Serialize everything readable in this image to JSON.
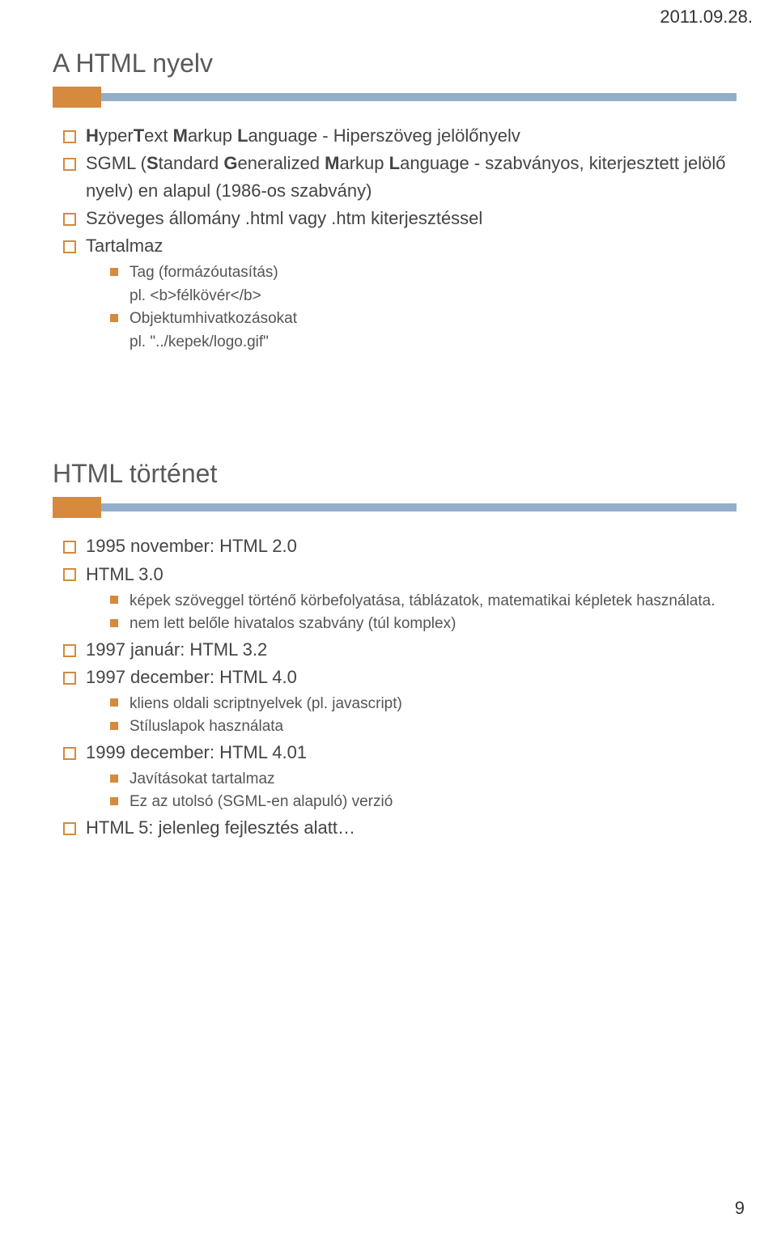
{
  "header": {
    "date": "2011.09.28."
  },
  "footer": {
    "page_number": "9"
  },
  "slide1": {
    "title": "A HTML nyelv",
    "items": [
      {
        "pre": "",
        "b1": "H",
        "mid1": "yper",
        "b2": "T",
        "mid2": "ext ",
        "b3": "M",
        "mid3": "arkup ",
        "b4": "L",
        "post": "anguage - Hiperszöveg jelölőnyelv"
      },
      {
        "pre": "SGML (",
        "b1": "S",
        "mid1": "tandard ",
        "b2": "G",
        "mid2": "eneralized ",
        "b3": "M",
        "mid3": "arkup ",
        "b4": "L",
        "post": "anguage - szabványos, kiterjesztett jelölő nyelv) en alapul (1986-os szabvány)"
      },
      {
        "text": "Szöveges állomány .html vagy .htm kiterjesztéssel"
      },
      {
        "text": "Tartalmaz"
      }
    ],
    "sub_tag": {
      "line1": "Tag (formázóutasítás)",
      "line2": "pl. <b>félkövér</b>"
    },
    "sub_obj": {
      "line1": "Objektumhivatkozásokat",
      "line2": "pl. \"../kepek/logo.gif\""
    }
  },
  "slide2": {
    "title": "HTML történet",
    "items": {
      "i1": "1995 november: HTML 2.0",
      "i2": "HTML 3.0",
      "i2a": "képek szöveggel történő körbefolyatása, táblázatok, matematikai képletek használata.",
      "i2b": "nem lett belőle hivatalos szabvány (túl komplex)",
      "i3": "1997 január: HTML 3.2",
      "i4": "1997 december: HTML 4.0",
      "i4a": "kliens oldali scriptnyelvek (pl. javascript)",
      "i4b": "Stíluslapok használata",
      "i5": "1999 december: HTML 4.01",
      "i5a": "Javításokat tartalmaz",
      "i5b": "Ez az utolsó (SGML-en alapuló) verzió",
      "i6": "HTML 5: jelenleg fejlesztés alatt…"
    }
  }
}
